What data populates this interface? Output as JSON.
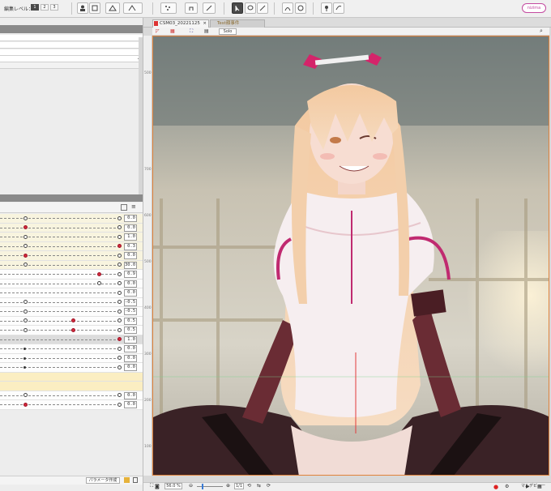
{
  "toolbar": {
    "level_label": "編集レベル：",
    "level_buttons": [
      "1",
      "2",
      "3"
    ],
    "logo_text": "nizima"
  },
  "params": {
    "values": [
      "0.0",
      "0.0",
      "1.0",
      "0.3",
      "0.0",
      "30.0",
      "0.9",
      "0.0",
      "0.0",
      "-0.5",
      "-0.5",
      "0.5",
      "0.5",
      "1.0",
      "0.0",
      "0.0",
      "0.0",
      "0.0",
      "0.0"
    ],
    "create_button": "パラメータ作成"
  },
  "canvas": {
    "tab_active": "CSM03_20221125",
    "tab_inactive": "Test顔事件",
    "solo_label": "Solo",
    "ruler_marks": [
      "500",
      "700",
      "600",
      "500",
      "400",
      "300",
      "200",
      "100"
    ],
    "zoom": "56.0 %",
    "ratio": "1/1",
    "footer_right": "マルデビュー"
  }
}
